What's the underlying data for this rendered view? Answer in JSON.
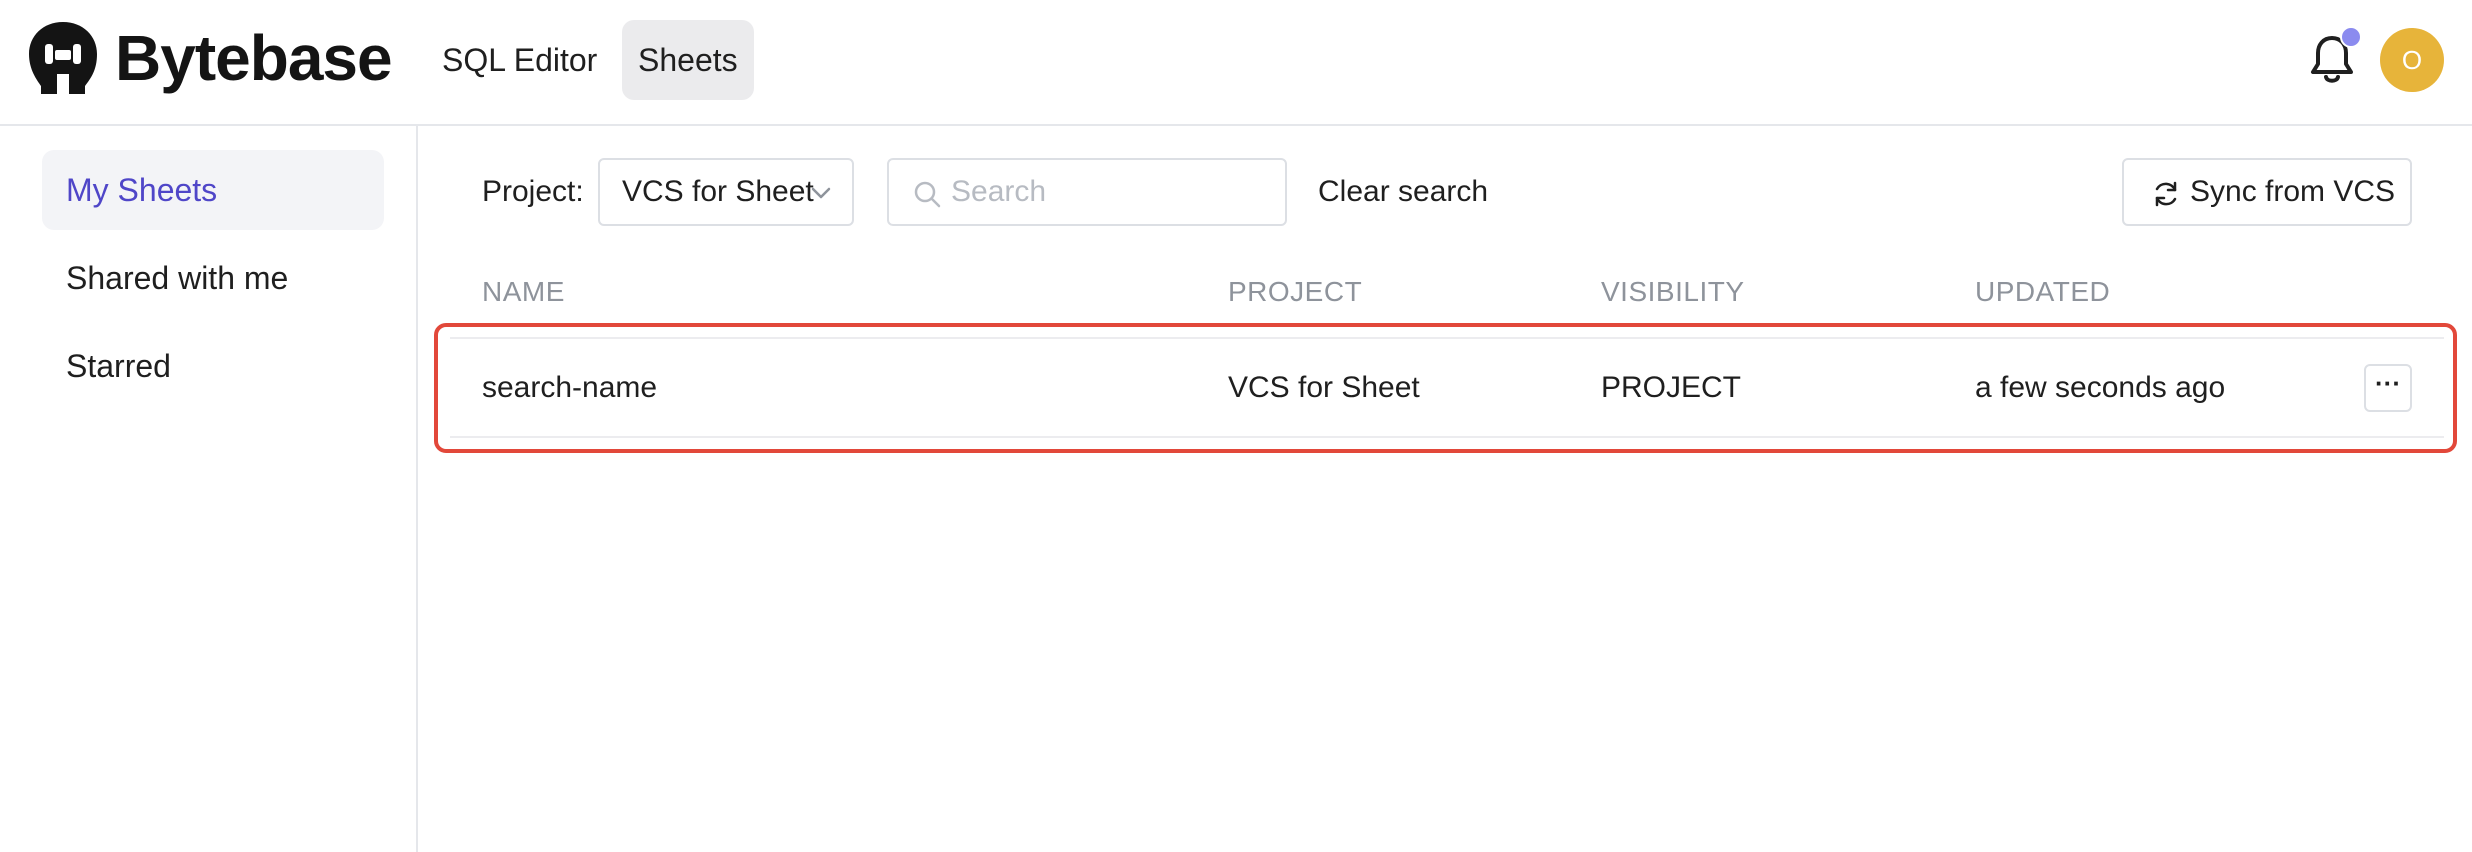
{
  "brand": {
    "name": "Bytebase"
  },
  "nav": {
    "tabs": [
      {
        "label": "SQL Editor"
      },
      {
        "label": "Sheets"
      }
    ],
    "active": "Sheets"
  },
  "user": {
    "avatar_initial": "O",
    "avatar_color": "#e7b43a",
    "notification_dot_color": "#8b8bef"
  },
  "sidebar": {
    "items": [
      {
        "label": "My Sheets"
      },
      {
        "label": "Shared with me"
      },
      {
        "label": "Starred"
      }
    ],
    "active": "My Sheets"
  },
  "toolbar": {
    "project_label": "Project:",
    "project_value": "VCS for Sheet",
    "search_placeholder": "Search",
    "search_value": "",
    "clear_label": "Clear search",
    "sync_label": "Sync from VCS"
  },
  "table": {
    "columns": [
      "NAME",
      "PROJECT",
      "VISIBILITY",
      "UPDATED"
    ],
    "rows": [
      {
        "name": "search-name",
        "project": "VCS for Sheet",
        "visibility": "PROJECT",
        "updated": "a few seconds ago",
        "more_label": "···"
      }
    ]
  },
  "colors": {
    "accent": "#4f46c8",
    "highlight_border": "#e2483a"
  },
  "icons": {
    "logo": "bytebase-logo-icon",
    "notifications": "bell-icon",
    "search": "search-icon",
    "sync": "refresh-icon",
    "dropdown": "chevron-down-icon"
  }
}
